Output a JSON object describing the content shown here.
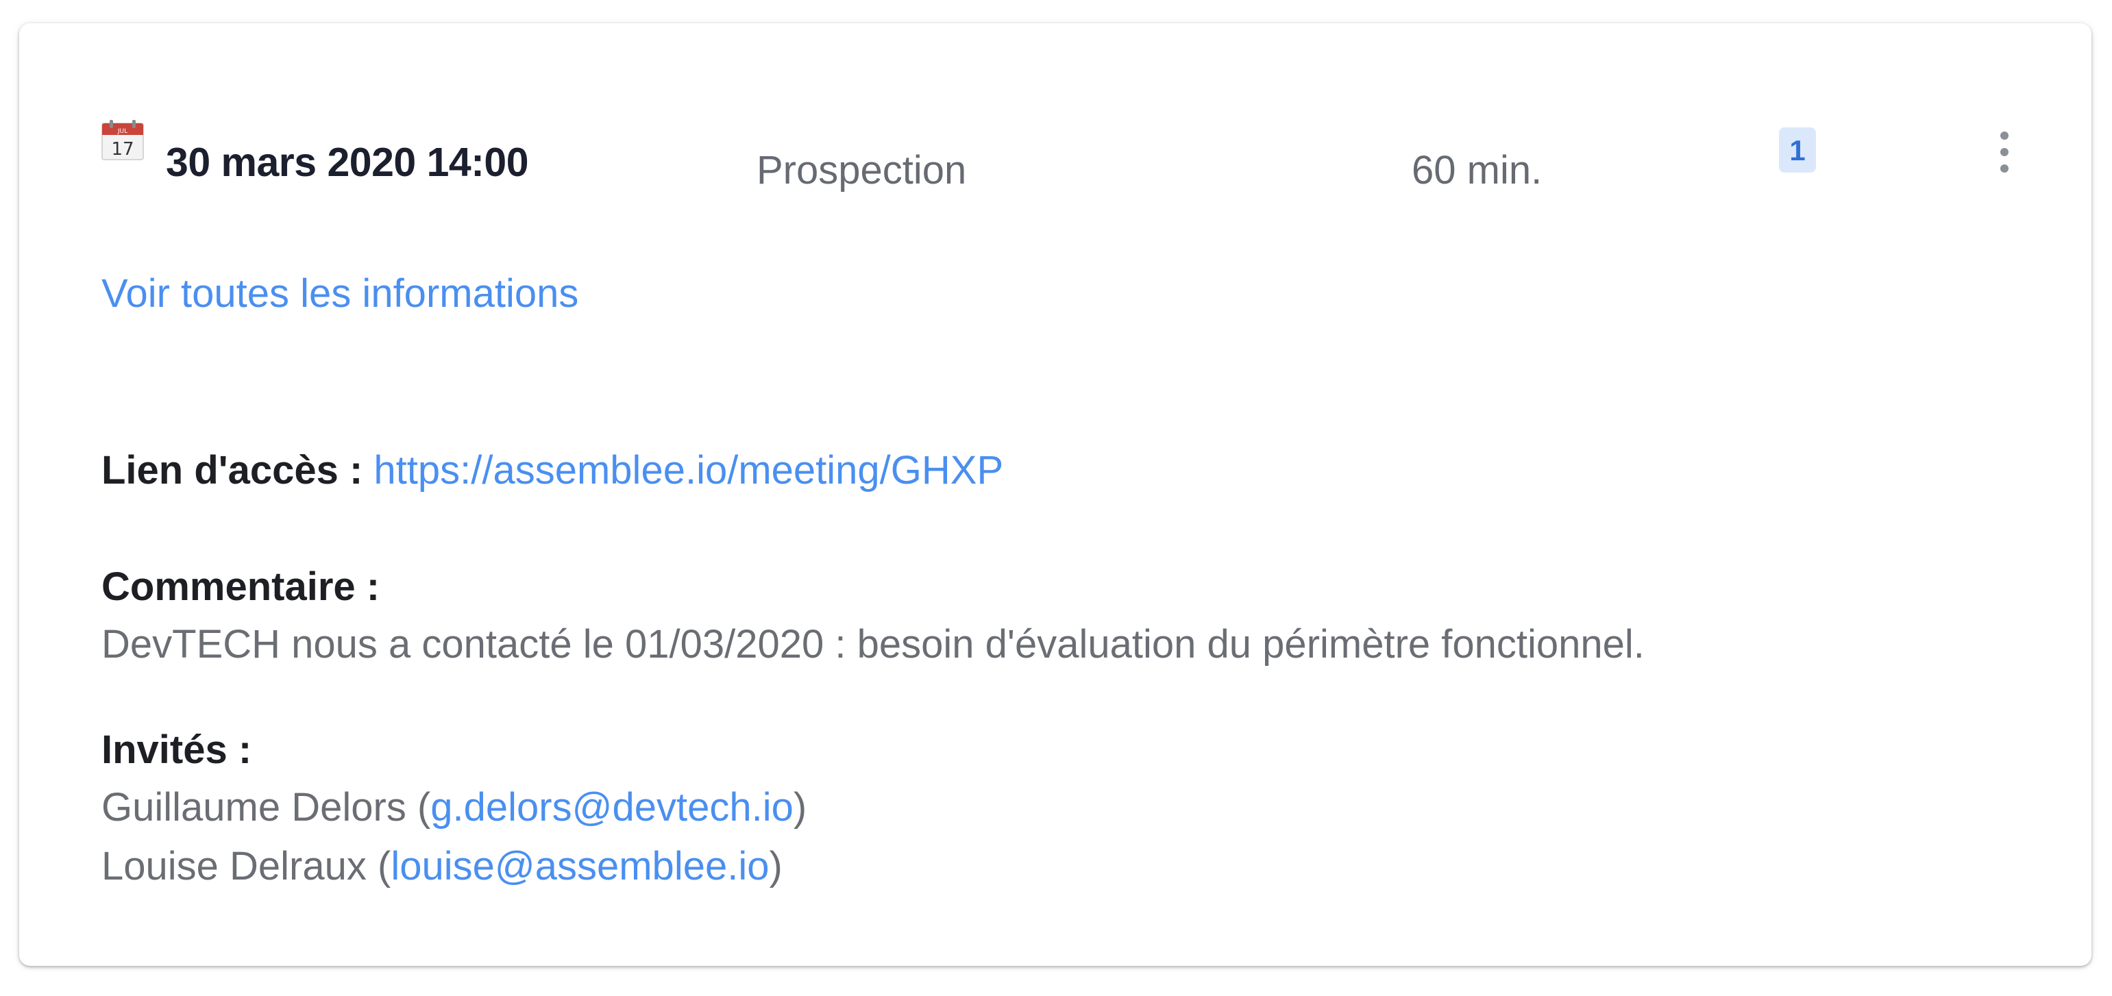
{
  "meeting": {
    "date": "30 mars 2020 14:00",
    "type": "Prospection",
    "duration": "60 min.",
    "badge_count": "1",
    "calendar_icon_day": "17",
    "calendar_icon_month": "JUL"
  },
  "see_all_link": "Voir toutes les informations",
  "access": {
    "label": "Lien d'accès : ",
    "url": "https://assemblee.io/meeting/GHXP"
  },
  "comment": {
    "label": "Commentaire :",
    "text": "DevTECH nous a contacté le 01/03/2020 : besoin d'évaluation du périmètre fonctionnel."
  },
  "guests": {
    "label": "Invités :",
    "items": [
      {
        "name": "Guillaume Delors (",
        "email": "g.delors@devtech.io",
        "close": ")"
      },
      {
        "name": "Louise Delraux (",
        "email": "louise@assemblee.io",
        "close": ")"
      }
    ]
  },
  "colors": {
    "link": "#4a8ff0",
    "badge_bg": "#dbe8fb",
    "badge_text": "#2f6fd8",
    "calendar_red": "#c9443b"
  }
}
